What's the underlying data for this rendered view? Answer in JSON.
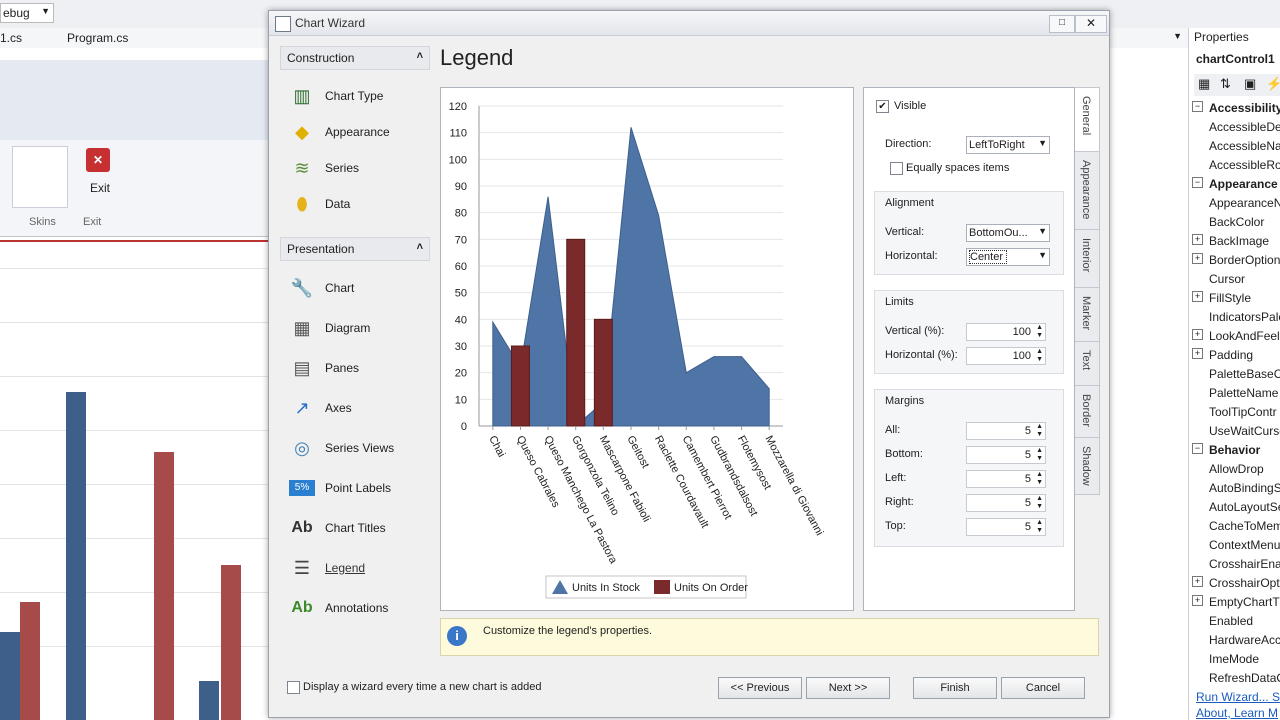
{
  "ide": {
    "toolbar_combo": "ebug",
    "tabs": [
      "1.cs",
      "Program.cs"
    ],
    "ribbon_exit_label": "Exit",
    "ribbon_group_skins": "Skins",
    "ribbon_group_exit": "Exit"
  },
  "properties": {
    "panel_title": "Properties",
    "object_name": "chartControl1",
    "rows": [
      {
        "label": "Accessibility",
        "category": true,
        "expander": "−"
      },
      {
        "label": "AccessibleDes",
        "category": false,
        "expander": ""
      },
      {
        "label": "AccessibleNa",
        "category": false,
        "expander": ""
      },
      {
        "label": "AccessibleRol",
        "category": false,
        "expander": ""
      },
      {
        "label": "Appearance",
        "category": true,
        "expander": "−"
      },
      {
        "label": "AppearanceN",
        "category": false,
        "expander": ""
      },
      {
        "label": "BackColor",
        "category": false,
        "expander": ""
      },
      {
        "label": "BackImage",
        "category": false,
        "expander": "+"
      },
      {
        "label": "BorderOption",
        "category": false,
        "expander": "+"
      },
      {
        "label": "Cursor",
        "category": false,
        "expander": ""
      },
      {
        "label": "FillStyle",
        "category": false,
        "expander": "+"
      },
      {
        "label": "IndicatorsPale",
        "category": false,
        "expander": ""
      },
      {
        "label": "LookAndFeel",
        "category": false,
        "expander": "+"
      },
      {
        "label": "Padding",
        "category": false,
        "expander": "+"
      },
      {
        "label": "PaletteBaseCo",
        "category": false,
        "expander": ""
      },
      {
        "label": "PaletteName",
        "category": false,
        "expander": ""
      },
      {
        "label": "ToolTipContr",
        "category": false,
        "expander": ""
      },
      {
        "label": "UseWaitCurso",
        "category": false,
        "expander": ""
      },
      {
        "label": "Behavior",
        "category": true,
        "expander": "−"
      },
      {
        "label": "AllowDrop",
        "category": false,
        "expander": ""
      },
      {
        "label": "AutoBindingS",
        "category": false,
        "expander": ""
      },
      {
        "label": "AutoLayoutSe",
        "category": false,
        "expander": ""
      },
      {
        "label": "CacheToMem",
        "category": false,
        "expander": ""
      },
      {
        "label": "ContextMenu",
        "category": false,
        "expander": ""
      },
      {
        "label": "CrosshairEnab",
        "category": false,
        "expander": ""
      },
      {
        "label": "CrosshairOpti",
        "category": false,
        "expander": "+"
      },
      {
        "label": "EmptyChartT",
        "category": false,
        "expander": "+"
      },
      {
        "label": "Enabled",
        "category": false,
        "expander": ""
      },
      {
        "label": "HardwareAcc",
        "category": false,
        "expander": ""
      },
      {
        "label": "ImeMode",
        "category": false,
        "expander": ""
      },
      {
        "label": "RefreshDataO",
        "category": false,
        "expander": ""
      }
    ],
    "link1": "Run Wizard... Se",
    "link2": "About, Learn M"
  },
  "dialog": {
    "title": "Chart Wizard",
    "maximize": "□",
    "close": "✕",
    "page_title": "Legend",
    "construction": {
      "header": "Construction",
      "items": [
        {
          "label": "Chart Type",
          "icon": "chart-type-icon",
          "glyph": "▥",
          "color": "#2d6e2d"
        },
        {
          "label": "Appearance",
          "icon": "appearance-icon",
          "glyph": "◆",
          "color": "#e0b000"
        },
        {
          "label": "Series",
          "icon": "series-icon",
          "glyph": "≋",
          "color": "#5a8f3a"
        },
        {
          "label": "Data",
          "icon": "data-icon",
          "glyph": "⬮",
          "color": "#e5b21a"
        }
      ]
    },
    "presentation": {
      "header": "Presentation",
      "items": [
        {
          "label": "Chart",
          "icon": "wrench-icon",
          "glyph": "🔧",
          "color": "#666"
        },
        {
          "label": "Diagram",
          "icon": "diagram-icon",
          "glyph": "▦",
          "color": "#555"
        },
        {
          "label": "Panes",
          "icon": "panes-icon",
          "glyph": "▤",
          "color": "#555"
        },
        {
          "label": "Axes",
          "icon": "axes-icon",
          "glyph": "↗",
          "color": "#2a6fc9"
        },
        {
          "label": "Series Views",
          "icon": "series-views-icon",
          "glyph": "◎",
          "color": "#3f7fb5"
        },
        {
          "label": "Point Labels",
          "icon": "point-labels-icon",
          "glyph": "5%",
          "color": "#2a7fd0"
        },
        {
          "label": "Chart Titles",
          "icon": "chart-titles-icon",
          "glyph": "Ab",
          "color": "#333"
        },
        {
          "label": "Legend",
          "icon": "legend-icon",
          "glyph": "☰",
          "color": "#444"
        },
        {
          "label": "Annotations",
          "icon": "annotations-icon",
          "glyph": "Ab",
          "color": "#3d8a2a"
        }
      ]
    },
    "settings": {
      "visible_label": "Visible",
      "visible_checked": true,
      "direction_label": "Direction:",
      "direction_value": "LeftToRight",
      "equally_label": "Equally spaces items",
      "alignment_header": "Alignment",
      "vertical_label": "Vertical:",
      "vertical_value": "BottomOu...",
      "horizontal_label": "Horizontal:",
      "horizontal_value": "Center",
      "limits_header": "Limits",
      "limit_vertical_label": "Vertical (%):",
      "limit_vertical_value": "100",
      "limit_horizontal_label": "Horizontal (%):",
      "limit_horizontal_value": "100",
      "margins_header": "Margins",
      "all_label": "All:",
      "all_value": "5",
      "bottom_label": "Bottom:",
      "bottom_value": "5",
      "left_label": "Left:",
      "left_value": "5",
      "right_label": "Right:",
      "right_value": "5",
      "top_label": "Top:",
      "top_value": "5",
      "tabs": [
        "General",
        "Appearance",
        "Interior",
        "Marker",
        "Text",
        "Border",
        "Shadow"
      ]
    },
    "info_text": "Customize the legend's properties.",
    "wizard_checkbox_label": "Display a wizard every time a new chart is added",
    "buttons": {
      "previous": "<< Previous",
      "next": "Next >>",
      "finish": "Finish",
      "cancel": "Cancel"
    }
  },
  "chart_data": {
    "type": "area",
    "categories": [
      "Chai",
      "Queso Cabrales",
      "Queso Manchego La Pastora",
      "Gorgonzola Telino",
      "Mascarpone Fabioli",
      "Geitost",
      "Raclette Courdavault",
      "Camembert Pierrot",
      "Gudbrandsdalsost",
      "Flotemysost",
      "Mozzarella di Giovanni"
    ],
    "series": [
      {
        "name": "Units In Stock",
        "kind": "area",
        "color": "#4f74a6",
        "values": [
          39,
          22,
          86,
          0,
          9,
          112,
          79,
          20,
          26,
          26,
          14
        ]
      },
      {
        "name": "Units On Order",
        "kind": "bar",
        "color": "#7a2a2a",
        "values": [
          0,
          30,
          0,
          70,
          40,
          0,
          0,
          0,
          0,
          0,
          0
        ]
      }
    ],
    "ylim": [
      0,
      120
    ],
    "yticks": [
      0,
      10,
      20,
      30,
      40,
      50,
      60,
      70,
      80,
      90,
      100,
      110,
      120
    ],
    "legend_position": "bottom-center",
    "grid": true
  }
}
